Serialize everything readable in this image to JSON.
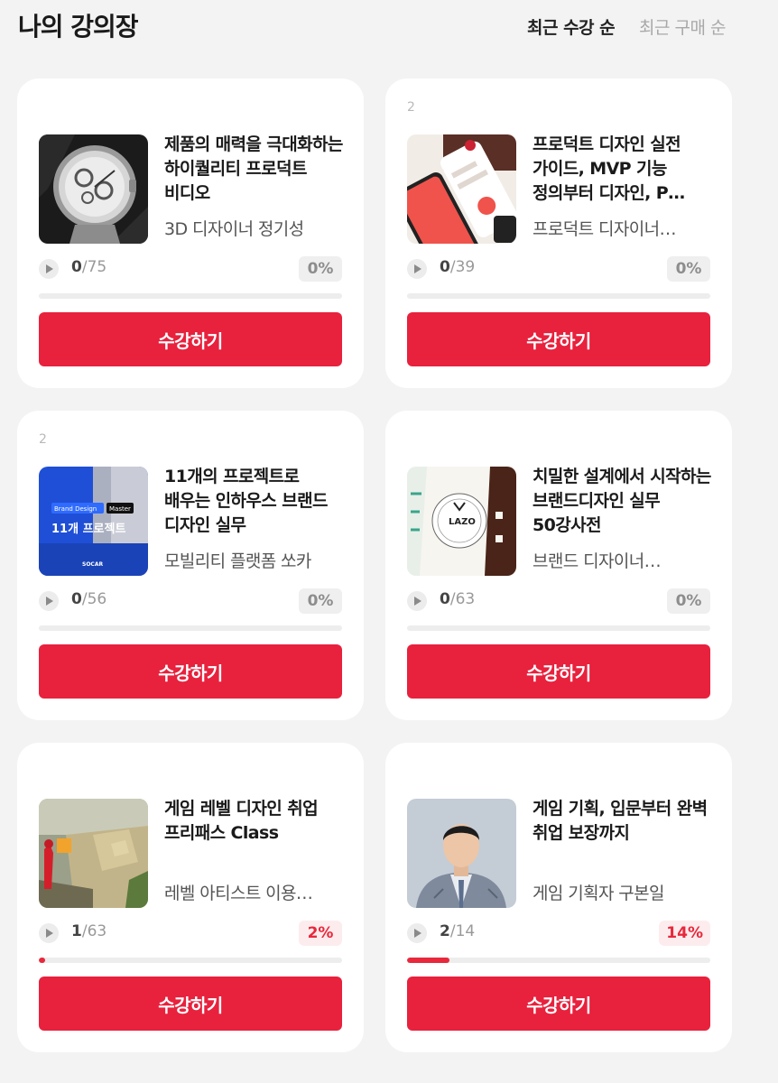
{
  "header": {
    "title": "나의 강의장",
    "sort_active": "최근 수강 순",
    "sort_inactive": "최근 구매 순"
  },
  "accent_color": "#e8213d",
  "cta_label": "수강하기",
  "courses": [
    {
      "title": "제품의 매력을 극대화하는 하이퀄리티 프로덕트 비디오",
      "instructor": "3D 디자이너 정기성",
      "done": "0",
      "total": "/75",
      "percent": "0%",
      "progress": 0,
      "thumbnail": "watch-photo"
    },
    {
      "rank": "2",
      "title": "프로덕트 디자인 실전 가이드, MVP 기능 정의부터 디자인, P…",
      "instructor": "프로덕트 디자이너…",
      "done": "0",
      "total": "/39",
      "percent": "0%",
      "progress": 0,
      "thumbnail": "app-screens-collage"
    },
    {
      "rank": "2",
      "title": "11개의 프로젝트로 배우는 인하우스 브랜드 디자인 실무",
      "instructor": "모빌리티 플랫폼 쏘카",
      "done": "0",
      "total": "/56",
      "percent": "0%",
      "progress": 0,
      "thumbnail": "brand-design-master",
      "thumb_tag1": "Brand Design",
      "thumb_tag2": "Master",
      "thumb_text": "11개 프로젝트",
      "thumb_brand": "SOCAR"
    },
    {
      "title": "치밀한 설계에서 시작하는 브랜드디자인 실무 50강사전",
      "instructor": "브랜드 디자이너…",
      "done": "0",
      "total": "/63",
      "percent": "0%",
      "progress": 0,
      "thumbnail": "packaging-mockup",
      "thumb_logo": "LAZO"
    },
    {
      "title": "게임 레벨 디자인 취업 프리패스 Class",
      "instructor": "레벨 아티스트 이용…",
      "done": "1",
      "total": "/63",
      "percent": "2%",
      "progress": 0.02,
      "thumbnail": "game-level-render"
    },
    {
      "title": "게임 기획, 입문부터 완벽 취업 보장까지",
      "instructor": "게임 기획자 구본일",
      "done": "2",
      "total": "/14",
      "percent": "14%",
      "progress": 0.14,
      "thumbnail": "instructor-portrait"
    }
  ]
}
